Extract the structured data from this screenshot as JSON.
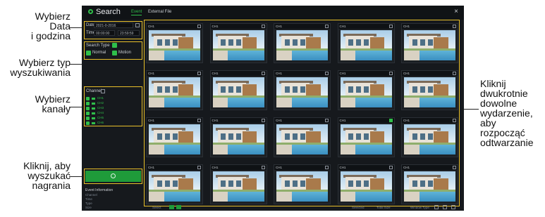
{
  "callouts": {
    "date": [
      "Wybierz",
      "Data",
      "i godzina"
    ],
    "type": [
      "Wybierz typ",
      "wyszukiwania"
    ],
    "channels": [
      "Wybierz",
      "kanały"
    ],
    "search": [
      "Kliknij, aby",
      "wyszukać",
      "nagrania"
    ],
    "playback": [
      "Kliknij",
      "dwukrotnie",
      "dowolne",
      "wydarzenie,",
      "aby rozpocząć",
      "odtwarzanie"
    ]
  },
  "app": {
    "title": "Search",
    "tabs": [
      "Event",
      "External File"
    ],
    "close": "×",
    "sidebar": {
      "date_label": "Date",
      "date_value": "2021-0-2016",
      "time_label": "Time",
      "time_from": "00:00:00",
      "time_to": "23:59:59",
      "search_type_label": "Search Type",
      "search_types": [
        "Normal",
        "Motion"
      ],
      "channel_label": "Channel",
      "channels": [
        "CH1",
        "CH2",
        "CH3",
        "CH4",
        "CH5",
        "CH6"
      ],
      "search_button_icon": "search-icon",
      "event_info_label": "Event Information",
      "info_fields": [
        "Channel",
        "Time",
        "Type",
        "Size"
      ]
    },
    "grid": {
      "rows": 4,
      "columns": 5,
      "tile_labels": [
        "CH1",
        "CH1",
        "CH1",
        "CH1",
        "CH1",
        "CH1",
        "CH1",
        "CH1",
        "CH1",
        "CH1",
        "CH1",
        "CH1",
        "CH1",
        "CH1",
        "CH1",
        "CH1",
        "CH1",
        "CH1",
        "CH1",
        "CH1"
      ],
      "selected_index": 13
    },
    "bottom": {
      "select_label": "Select",
      "selected_label": "Selected",
      "total_size_label": "Total Size",
      "show_type_label": "Window Type"
    },
    "colors": {
      "accent": "#2fbf4a",
      "highlight": "#e9c02a",
      "background": "#16191d"
    }
  }
}
